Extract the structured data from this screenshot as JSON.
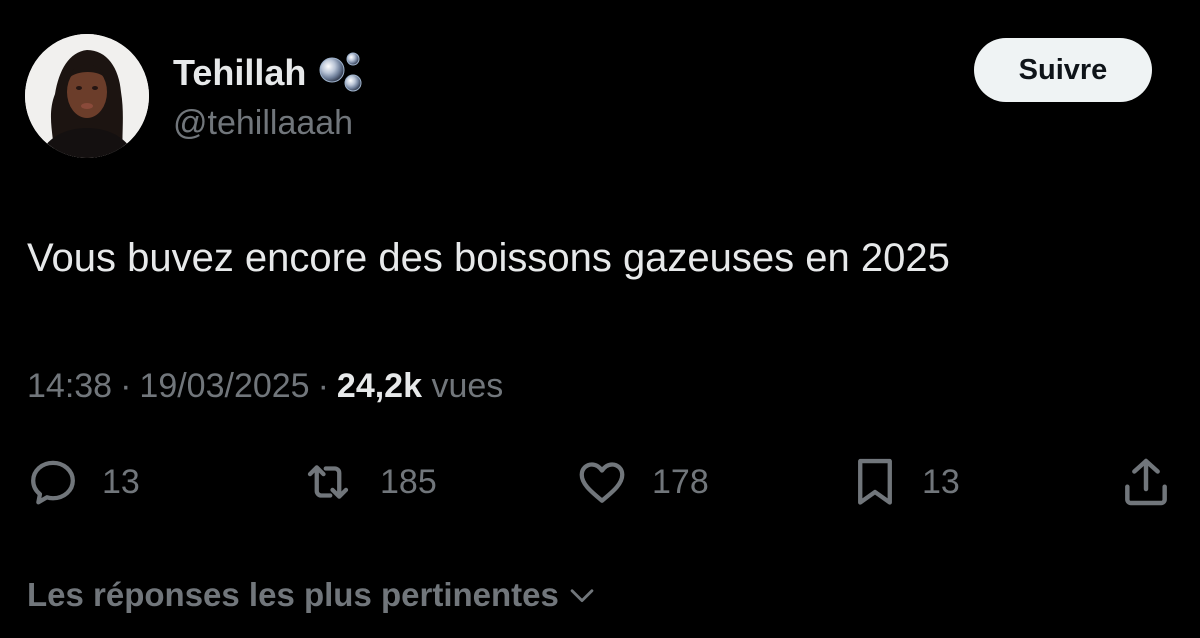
{
  "author": {
    "display_name": "Tehillah",
    "handle": "@tehillaaah",
    "name_emoji_icon": "bubbles-icon"
  },
  "follow": {
    "label": "Suivre"
  },
  "tweet": {
    "text": "Vous buvez encore des boissons gazeuses en 2025",
    "time": "14:38",
    "date": "19/03/2025",
    "separator": "·",
    "views_count": "24,2k",
    "views_label": "vues"
  },
  "actions": {
    "replies": {
      "icon": "reply-icon",
      "count": "13"
    },
    "reposts": {
      "icon": "repost-icon",
      "count": "185"
    },
    "likes": {
      "icon": "heart-icon",
      "count": "178"
    },
    "bookmarks": {
      "icon": "bookmark-icon",
      "count": "13"
    },
    "share": {
      "icon": "share-icon"
    }
  },
  "replies_sort": {
    "label": "Les réponses les plus pertinentes",
    "icon": "chevron-down-icon"
  },
  "colors": {
    "background": "#000000",
    "primary_text": "#e7e9ea",
    "secondary_text": "#71767b",
    "button_bg": "#eff3f4",
    "button_text": "#0f1419"
  }
}
